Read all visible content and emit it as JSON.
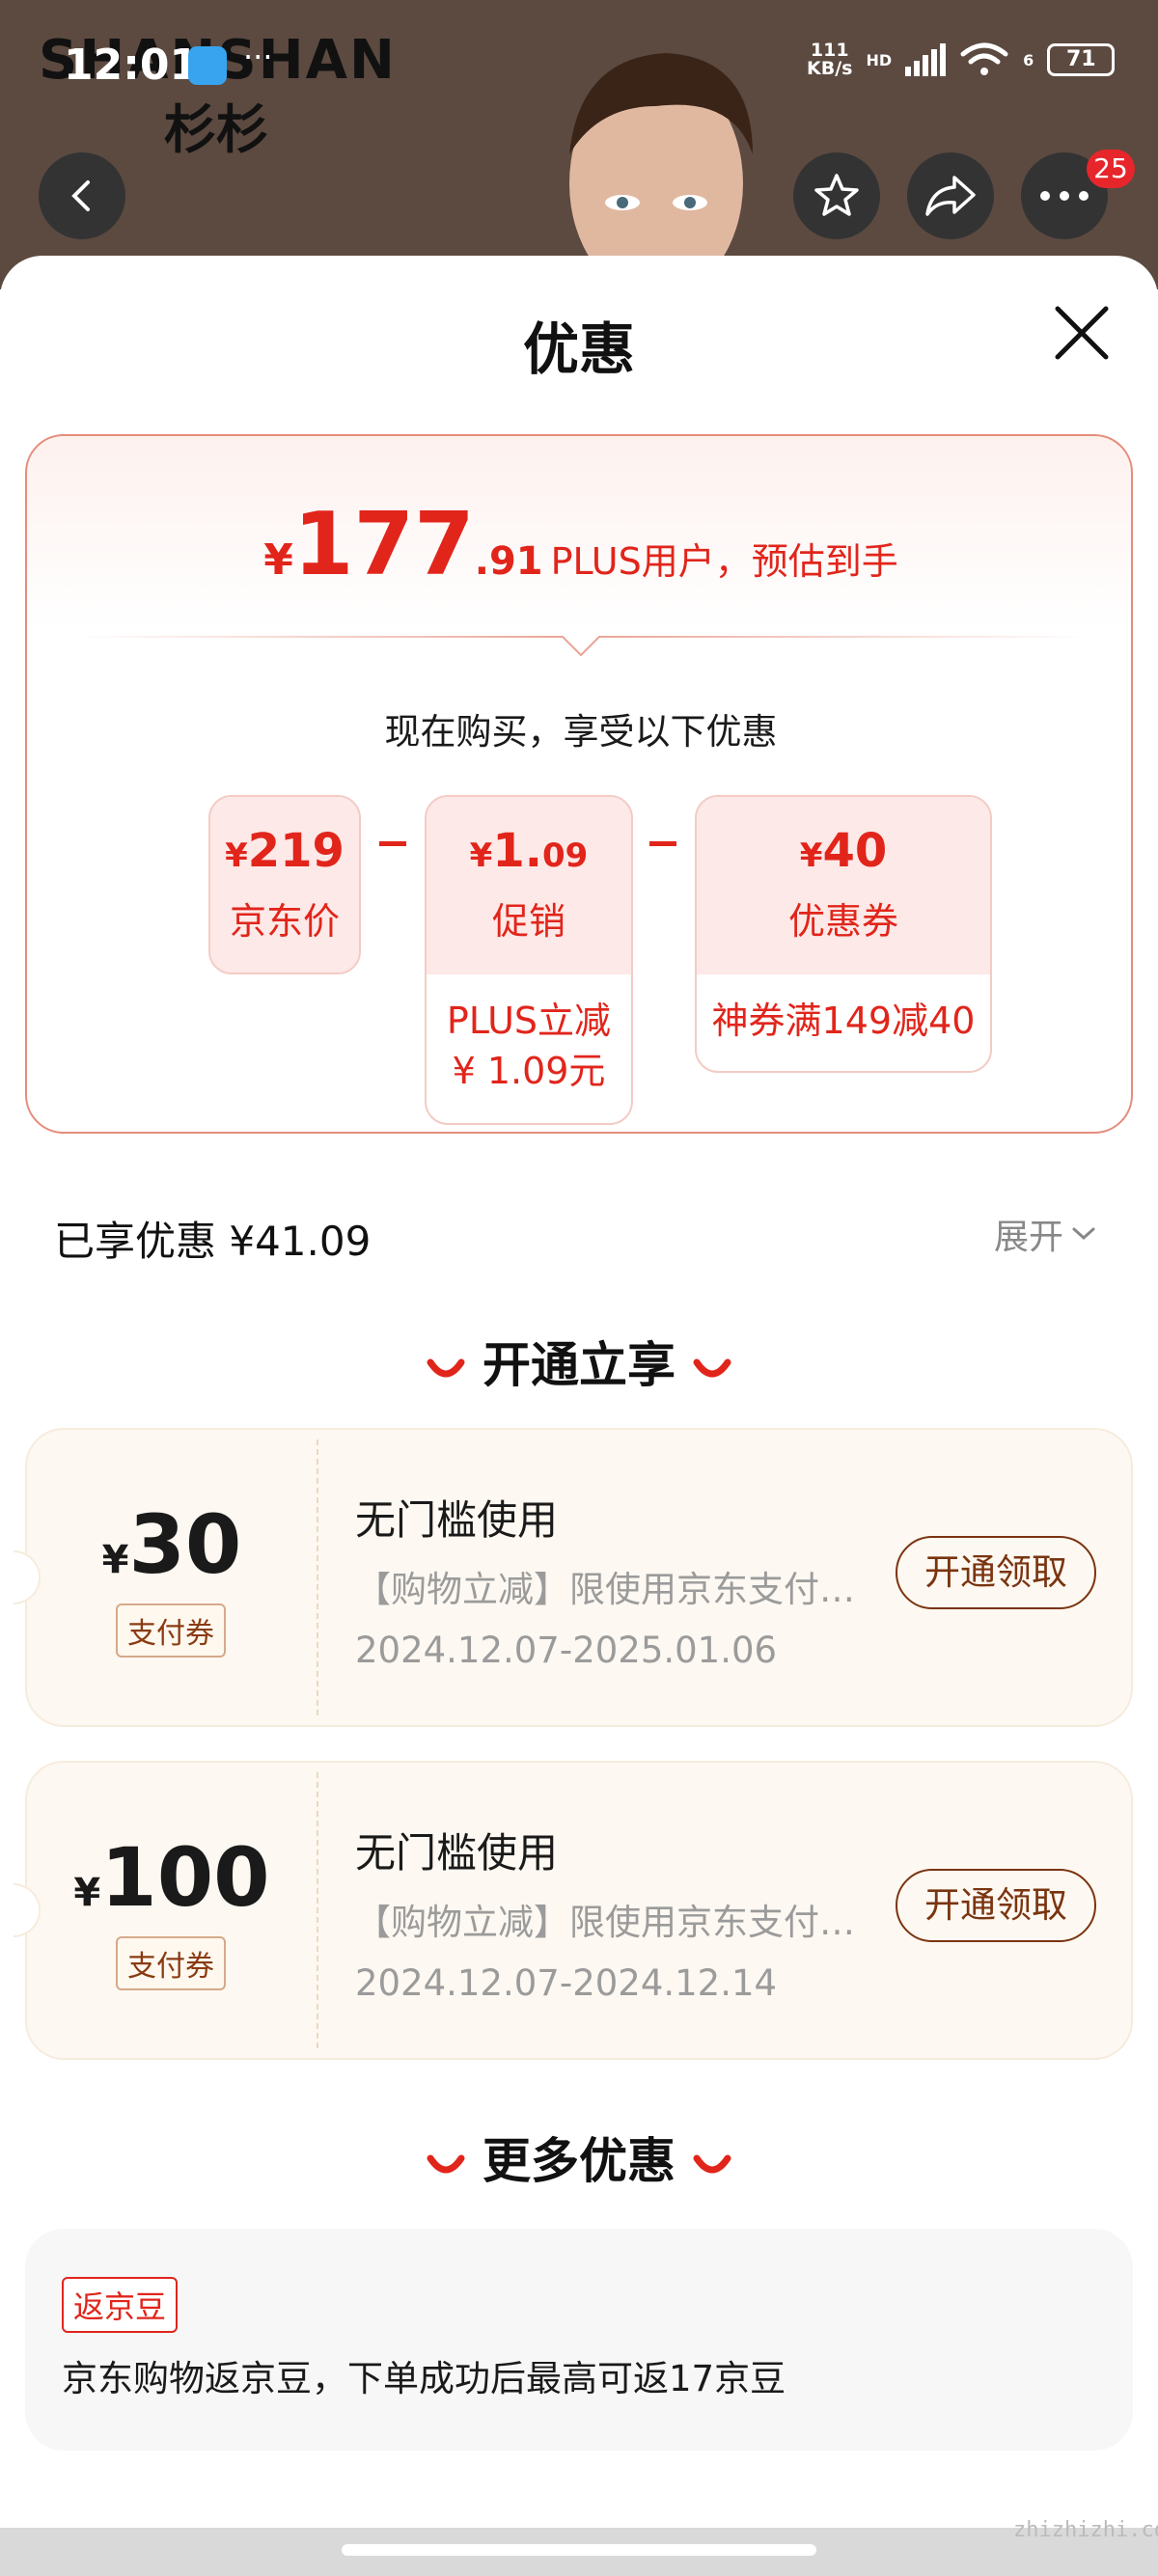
{
  "status_bar": {
    "time": "12:01",
    "overflow": "···",
    "net_speed_value": "111",
    "net_speed_unit": "KB/s",
    "signal_label": "HD",
    "wifi_label": "6",
    "battery": "71"
  },
  "product_bg": {
    "brand_en": "SHANSHAN",
    "brand_cn": "杉杉"
  },
  "nav": {
    "badge_count": "25"
  },
  "sheet": {
    "title": "优惠"
  },
  "price": {
    "currency": "¥",
    "integer": "177",
    "decimal": ".91",
    "note": "PLUS用户，预估到手",
    "buy_line": "现在购买，享受以下优惠"
  },
  "breakdown": [
    {
      "value_prefix": "¥",
      "value": "219",
      "value_small": "",
      "label": "京东价",
      "detail_1": "",
      "detail_2": ""
    },
    {
      "value_prefix": "¥",
      "value": "1.",
      "value_small": "09",
      "label": "促销",
      "detail_1": "PLUS立减",
      "detail_2": "¥ 1.09元"
    },
    {
      "value_prefix": "¥",
      "value": "40",
      "value_small": "",
      "label": "优惠券",
      "detail_1": "神券满149减40",
      "detail_2": ""
    }
  ],
  "summary": {
    "enjoyed": "已享优惠 ¥41.09",
    "expand": "展开"
  },
  "sections": {
    "open_title": "开通立享",
    "more_title": "更多优惠"
  },
  "coupons": [
    {
      "yen": "¥",
      "amount": "30",
      "tag": "支付券",
      "title": "无门槛使用",
      "desc": "【购物立减】限使用京东支付，部分商品可用",
      "dates": "2024.12.07-2025.01.06",
      "button": "开通领取"
    },
    {
      "yen": "¥",
      "amount": "100",
      "tag": "支付券",
      "title": "无门槛使用",
      "desc": "【购物立减】限使用京东支付，部分商品可用",
      "dates": "2024.12.07-2024.12.14",
      "button": "开通领取"
    }
  ],
  "more": {
    "tag": "返京豆",
    "text": "京东购物返京豆，下单成功后最高可返17京豆"
  },
  "watermark": "zhizhizhi.com",
  "colors": {
    "accent_red": "#e1251b",
    "coupon_brown": "#8a3b12",
    "coupon_bg": "#fdf8f1"
  }
}
